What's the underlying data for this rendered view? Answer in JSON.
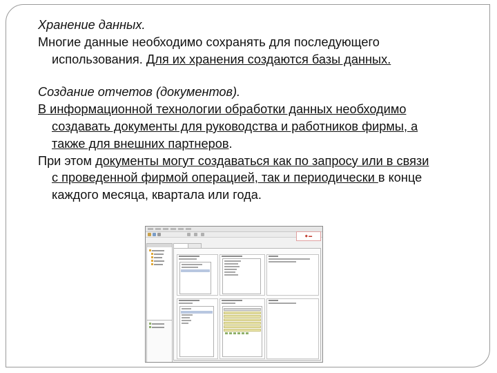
{
  "slide": {
    "heading1": "Хранение данных.",
    "para1_line1": "Многие данные необходимо сохранять для последующего",
    "para1_line2_plain": "использования. ",
    "para1_line2_underlined": "Для их хранения создаются базы данных.",
    "heading2": "Создание отчетов (документов).",
    "para2_line1_underlined": " В информационной технологии обработки данных необходимо",
    "para2_line2_underlined": "создавать документы для руководства и работников фирмы, а",
    "para2_line3_underlined": "также для внешних партнеров",
    "para2_line3_plain": ".",
    "para3_line1_plain": "При этом ",
    "para3_line1_underlined": "документы могут создаваться как по запросу или в связи",
    "para3_line2_underlined": "с проведенной фирмой операцией, так и периодически ",
    "para3_line2_plain": "в конце",
    "para3_line3": "каждого месяца, квартала или года."
  },
  "screenshot": {
    "description_icon": "application-window-screenshot"
  }
}
